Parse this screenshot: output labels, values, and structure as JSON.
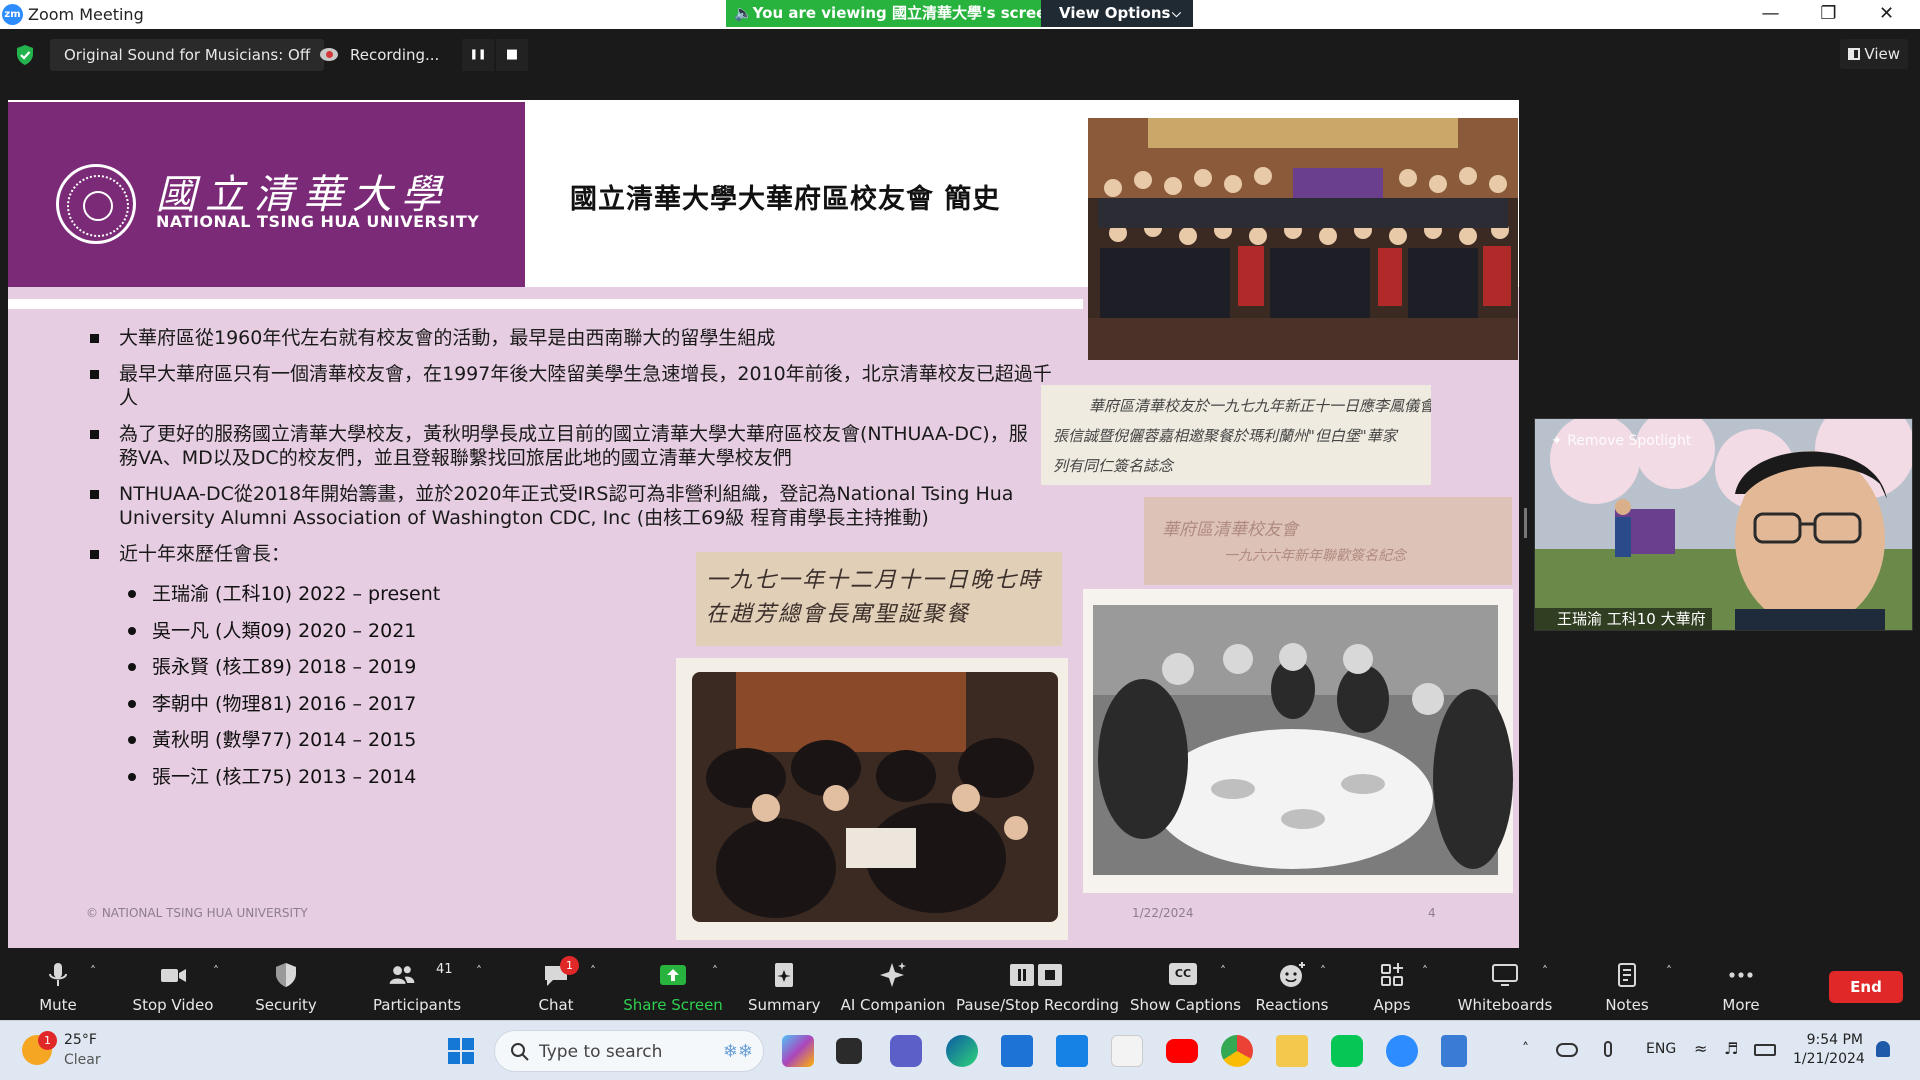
{
  "window": {
    "app_title": "Zoom Meeting",
    "logo_text": "zm",
    "viewing_banner": "🔈You are viewing 國立清華大學's screen",
    "view_options": "View Options",
    "minimize": "—",
    "restore": "❐",
    "close": "✕"
  },
  "topbar": {
    "original_sound": "Original Sound for Musicians: Off",
    "recording": "Recording...",
    "pause_glyph": "❚❚",
    "stop_glyph": "■",
    "view": "View"
  },
  "slide": {
    "logo_cjk": "國立清華大學",
    "logo_en": "NATIONAL TSING HUA UNIVERSITY",
    "title": "國立清華大學大華府區校友會 簡史",
    "bullets": [
      "大華府區從1960年代左右就有校友會的活動，最早是由西南聯大的留學生組成",
      "最早大華府區只有一個清華校友會，在1997年後大陸留美學生急速增長，2010年前後，北京清華校友已超過千人",
      "為了更好的服務國立清華大學校友，黃秋明學長成立目前的國立清華大學大華府區校友會(NTHUAA-DC)，服務VA、MD以及DC的校友們，並且登報聯繫找回旅居此地的國立清華大學校友們",
      "NTHUAA-DC從2018年開始籌畫，並於2020年正式受IRS認可為非營利組織，登記為National Tsing Hua University Alumni Association of Washington CDC, Inc (由核工69級 程育甫學長主持推動)",
      "近十年來歷任會長："
    ],
    "presidents": [
      "王瑞渝 (工科10) 2022 – present",
      "吳一凡 (人類09) 2020 – 2021",
      "張永賢 (核工89) 2018 – 2019",
      "李朝中 (物理81) 2016 – 2017",
      "黃秋明 (數學77) 2014 – 2015",
      "張一江 (核工75) 2013 – 2014"
    ],
    "photo_caption_1": "一九七一年十二月十一日晚七時 在趙芳總會長寓聖誕聚餐",
    "photo_caption_2_line1": "華府區清華校友於一九七九年新正十一日應李鳳儀會長",
    "photo_caption_2_line2": "張信誠暨倪儷蓉嘉相邀聚餐於瑪利蘭州\"但白堡\"華家",
    "photo_caption_2_line3": "列有同仁簽名誌念",
    "photo_caption_3_line1": "華府區清華校友會",
    "photo_caption_3_line2": "一九六六年新年聯歡簽名紀念",
    "footer_left": "© NATIONAL  TSING  HUA UNIVERSITY",
    "footer_date": "1/22/2024",
    "footer_page": "4"
  },
  "participant": {
    "remove_spotlight": "Remove Spotlight",
    "name": "王瑞渝 工科10 大華府"
  },
  "toolbar": {
    "mute": "Mute",
    "stop_video": "Stop Video",
    "security": "Security",
    "participants": "Participants",
    "participants_count": "41",
    "chat": "Chat",
    "chat_badge": "1",
    "share_screen": "Share Screen",
    "summary": "Summary",
    "ai_companion": "AI Companion",
    "pause_stop_recording": "Pause/Stop Recording",
    "show_captions": "Show Captions",
    "captions_glyph": "CC",
    "reactions": "Reactions",
    "apps": "Apps",
    "whiteboards": "Whiteboards",
    "notes": "Notes",
    "more": "More",
    "end": "End",
    "caret": "˄"
  },
  "taskbar": {
    "weather_badge": "1",
    "temperature": "25°F",
    "condition": "Clear",
    "search_placeholder": "Type to search",
    "language": "ENG",
    "up_caret": "˄",
    "time": "9:54 PM",
    "date": "1/21/2024"
  },
  "colors": {
    "zoom_blue": "#2d8cff",
    "share_green": "#27b33d",
    "end_red": "#e02828",
    "nthu_purple": "#7a2a77",
    "slide_pink": "#e6cde2"
  }
}
